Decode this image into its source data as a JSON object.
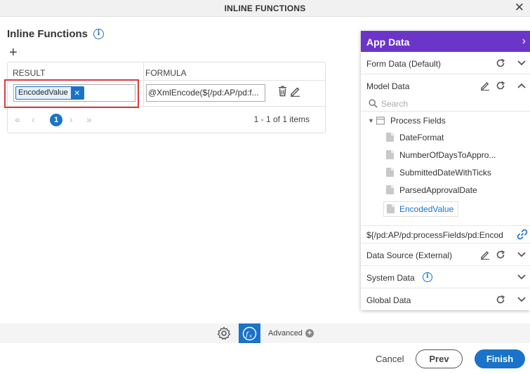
{
  "window": {
    "title": "INLINE FUNCTIONS",
    "close_label": "✕"
  },
  "page": {
    "heading": "Inline Functions",
    "info_icon": "info-icon",
    "add_icon": "plus-icon"
  },
  "grid": {
    "columns": [
      "RESULT",
      "FORMULA"
    ],
    "rows": [
      {
        "result_chip": "EncodedValue",
        "formula": "@XmlEncode(${/pd:AP/pd:f..."
      }
    ],
    "pager": {
      "current_page": "1",
      "summary": "1 - 1 of 1 items"
    }
  },
  "app_data": {
    "title": "App Data",
    "sections": {
      "form_data": "Form Data (Default)",
      "model_data": "Model Data",
      "data_source": "Data Source (External)",
      "system_data": "System Data",
      "global_data": "Global Data"
    },
    "search_placeholder": "Search",
    "tree_root": "Process Fields",
    "tree_items": [
      "DateFormat",
      "NumberOfDaysToAppro...",
      "SubmittedDateWithTicks",
      "ParsedApprovalDate",
      "EncodedValue"
    ],
    "selected_item": "EncodedValue",
    "selected_path": "${/pd:AP/pd:processFields/pd:Encod"
  },
  "footer": {
    "advanced_label": "Advanced"
  },
  "actions": {
    "cancel": "Cancel",
    "prev": "Prev",
    "finish": "Finish"
  },
  "colors": {
    "accent": "#1a73c8",
    "panel_header": "#6b35c9",
    "highlight": "#e0383e"
  }
}
